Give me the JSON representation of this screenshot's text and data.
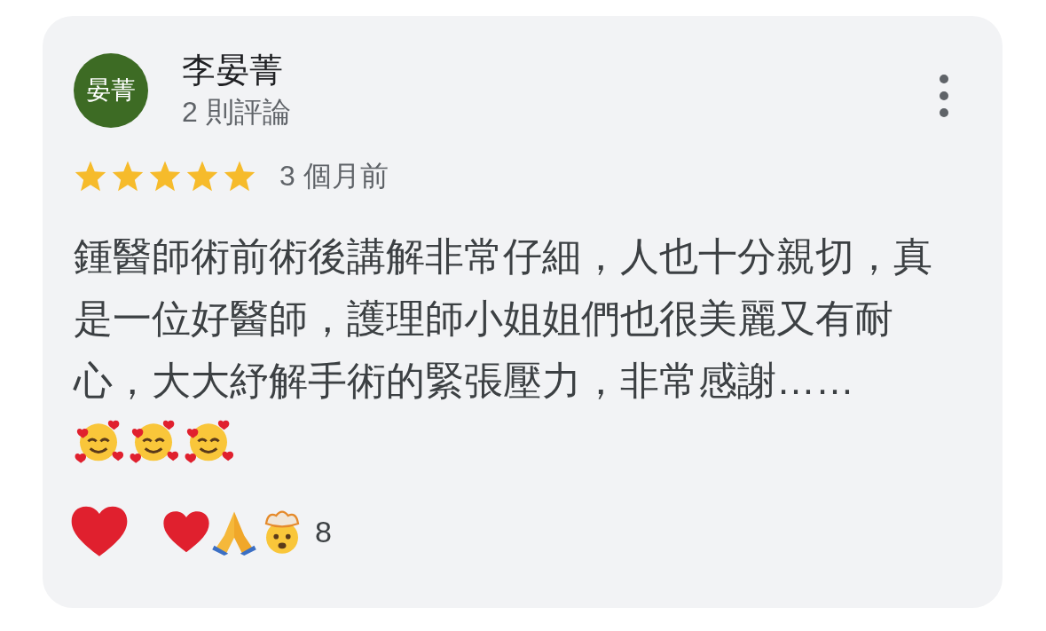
{
  "reviewer": {
    "avatar_text": "晏菁",
    "name": "李晏菁",
    "review_count": "2 則評論"
  },
  "rating": {
    "stars": 5,
    "time": "3 個月前"
  },
  "review": {
    "text": "鍾醫師術前術後講解非常仔細，人也十分親切，真是一位好醫師，護理師小姐姐們也很美麗又有耐心，大大紓解手術的緊張壓力，非常感謝……",
    "emojis": [
      {
        "kind": "smiling-hearts"
      },
      {
        "kind": "smiling-hearts"
      },
      {
        "kind": "smiling-hearts"
      }
    ]
  },
  "reactions": {
    "summary": [
      {
        "kind": "heart"
      },
      {
        "kind": "pray"
      },
      {
        "kind": "exploding-head"
      }
    ],
    "count": "8"
  }
}
